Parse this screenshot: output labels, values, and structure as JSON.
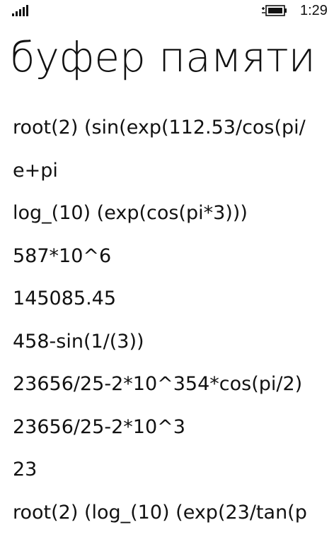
{
  "status_bar": {
    "signal_icon": "signal-strength-icon",
    "battery_icon": "battery-charging-icon",
    "time": "1:29"
  },
  "page": {
    "title": "буфер памяти"
  },
  "history": {
    "items": [
      "root(2) (sin(exp(112.53/cos(pi/",
      "e+pi",
      "log_(10) (exp(cos(pi*3)))",
      "587*10^6",
      "145085.45",
      "458-sin(1/(3))",
      "23656/25-2*10^354*cos(pi/2)",
      "23656/25-2*10^3",
      "23",
      "root(2) (log_(10) (exp(23/tan(p"
    ]
  },
  "colors": {
    "background": "#ffffff",
    "text": "#111111"
  }
}
